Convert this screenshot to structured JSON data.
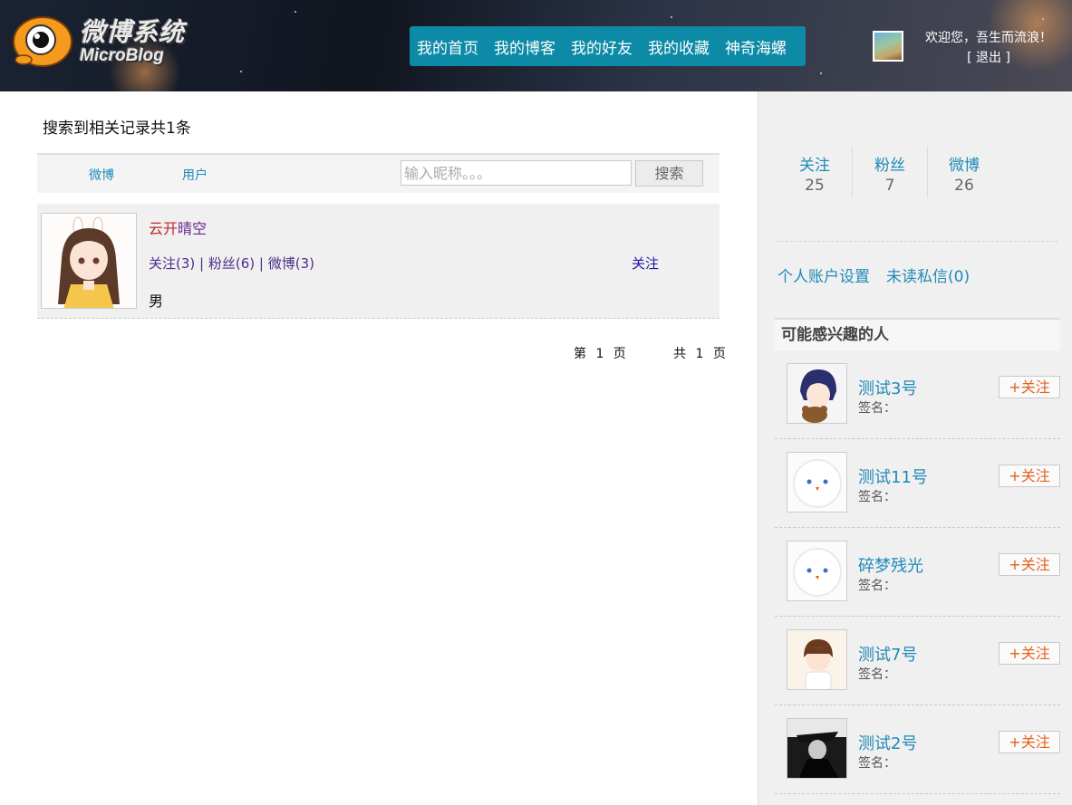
{
  "header": {
    "logo_cn": "微博系统",
    "logo_en": "MicroBlog",
    "nav": [
      "我的首页",
      "我的博客",
      "我的好友",
      "我的收藏",
      "神奇海螺"
    ],
    "welcome": "欢迎您，吾生而流浪！",
    "logout": "[ 退出 ]"
  },
  "main": {
    "result_count": "搜索到相关记录共1条",
    "tabs": [
      "微博",
      "用户"
    ],
    "search_placeholder": "输入昵称。。。",
    "search_button": "搜索",
    "results": [
      {
        "name_first": "云开",
        "name_rest": "晴空",
        "follows": "关注(3)",
        "fans": "粉丝(6)",
        "posts": "微博(3)",
        "sep": "|",
        "gender": "男",
        "follow_label": "关注"
      }
    ],
    "pager": {
      "current": "第 1 页",
      "total": "共 1 页"
    }
  },
  "sidebar": {
    "stats": [
      {
        "label": "关注",
        "value": "25"
      },
      {
        "label": "粉丝",
        "value": "7"
      },
      {
        "label": "微博",
        "value": "26"
      }
    ],
    "links": [
      "个人账户设置",
      "未读私信(0)"
    ],
    "recommend_title": "可能感兴趣的人",
    "recommend": [
      {
        "name": "测试3号",
        "sign": "签名：",
        "follow": "+关注"
      },
      {
        "name": "测试11号",
        "sign": "签名：",
        "follow": "+关注"
      },
      {
        "name": "碎梦残光",
        "sign": "签名：",
        "follow": "+关注"
      },
      {
        "name": "测试7号",
        "sign": "签名：",
        "follow": "+关注"
      },
      {
        "name": "测试2号",
        "sign": "签名：",
        "follow": "+关注"
      }
    ]
  },
  "colors": {
    "accent": "#1f8ab8",
    "nav_bg": "#0c8aa6",
    "follow_orange": "#e4621c",
    "name_red": "#c0282d"
  }
}
